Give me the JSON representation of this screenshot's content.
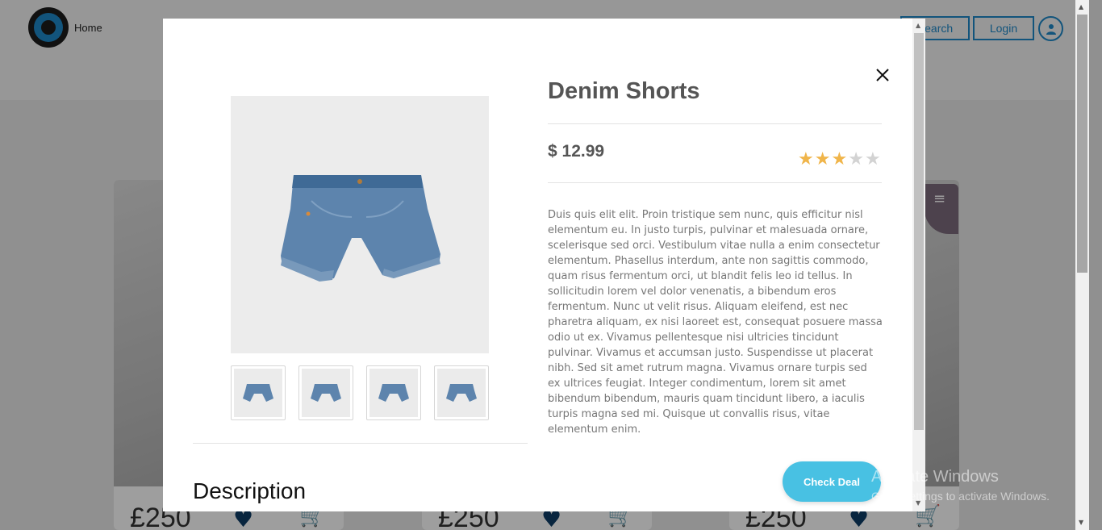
{
  "header": {
    "home_label": "Home",
    "search_label": "Search",
    "login_label": "Login"
  },
  "cards": [
    {
      "price": "£250"
    },
    {
      "price": "£250"
    },
    {
      "price": "£250"
    }
  ],
  "product": {
    "title": "Denim Shorts",
    "price": "$ 12.99",
    "rating": 3,
    "rating_max": 5,
    "description": "Duis quis elit elit. Proin tristique sem nunc, quis efficitur nisl elementum eu. In justo turpis, pulvinar et malesuada ornare, scelerisque sed orci. Vestibulum vitae nulla a enim consectetur elementum. Phasellus interdum, ante non sagittis commodo, quam risus fermentum orci, ut blandit felis leo id tellus. In sollicitudin lorem vel dolor venenatis, a bibendum eros fermentum. Nunc ut velit risus. Aliquam eleifend, est nec pharetra aliquam, ex nisi laoreet est, consequat posuere massa odio ut ex. Vivamus pellentesque nisi ultricies tincidunt pulvinar. Vivamus et accumsan justo. Suspendisse ut placerat nibh. Sed sit amet rutrum magna. Vivamus ornare turpis sed ex ultrices feugiat. Integer condimentum, lorem sit amet bibendum bibendum, mauris quam tincidunt libero, a iaculis turpis magna sed mi. Quisque ut convallis risus, vitae elementum enim.",
    "cta_label": "Check Deal",
    "section_heading": "Description",
    "thumbnail_count": 4
  },
  "watermark": {
    "line1": "Activate Windows",
    "line2": "Go to Settings to activate Windows."
  },
  "colors": {
    "accent": "#1e88c9",
    "cta": "#48c1e3",
    "star_on": "#f0b54a",
    "star_off": "#d3d3d3"
  }
}
